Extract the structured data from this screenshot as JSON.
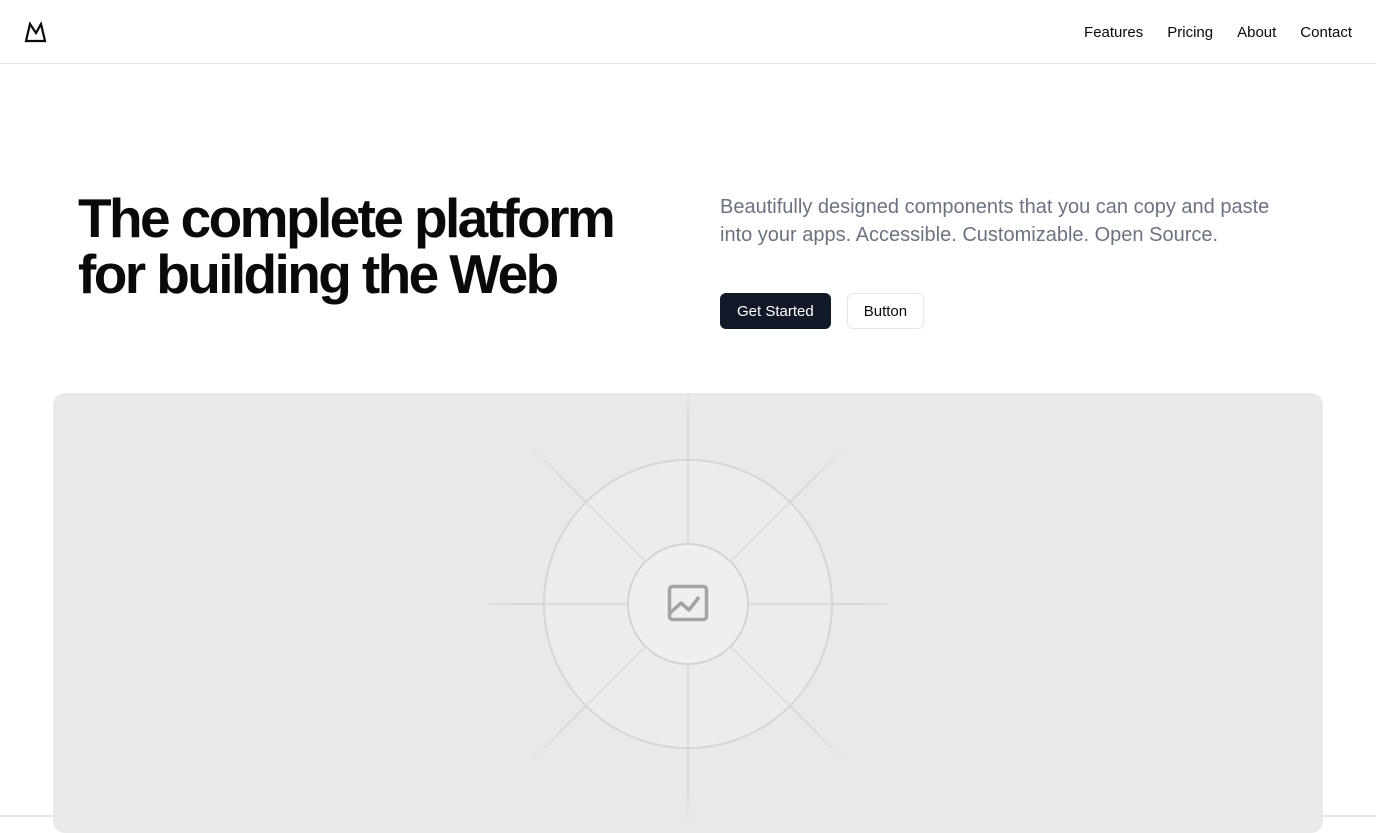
{
  "header": {
    "logo_icon": "mountain-logo-icon",
    "nav": [
      {
        "label": "Features"
      },
      {
        "label": "Pricing"
      },
      {
        "label": "About"
      },
      {
        "label": "Contact"
      }
    ]
  },
  "hero": {
    "title_line1": "The complete platform",
    "title_line2": "for building the Web",
    "description": "Beautifully designed components that you can copy and paste into your apps. Accessible. Customizable. Open Source.",
    "primary_button": "Get Started",
    "secondary_button": "Button"
  },
  "media": {
    "placeholder_icon": "image-placeholder-icon"
  },
  "colors": {
    "primary": "#111827",
    "muted_text": "#6b7280",
    "border": "#e5e7eb",
    "placeholder_bg": "#e9e9e9"
  }
}
